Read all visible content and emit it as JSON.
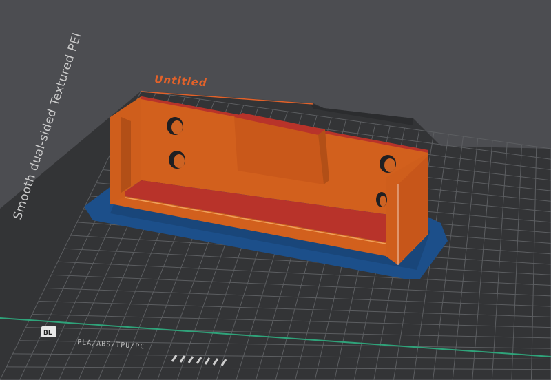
{
  "plate": {
    "title": "Untitled"
  },
  "bed": {
    "sheet_label": "Smooth dual-sided Textured PEI",
    "filament_label": "PLA/ABS/TPU/PC",
    "logo_text": "BL"
  },
  "colors": {
    "background": "#4c4d51",
    "bed_surface": "#333436",
    "grid_line": "#5c5e61",
    "model_orange": "#d2601d",
    "model_red_face": "#b8332a",
    "brim_blue": "#1c4f8a",
    "bed_edge_green": "#2fa37a",
    "title_orange": "#e2622a"
  }
}
